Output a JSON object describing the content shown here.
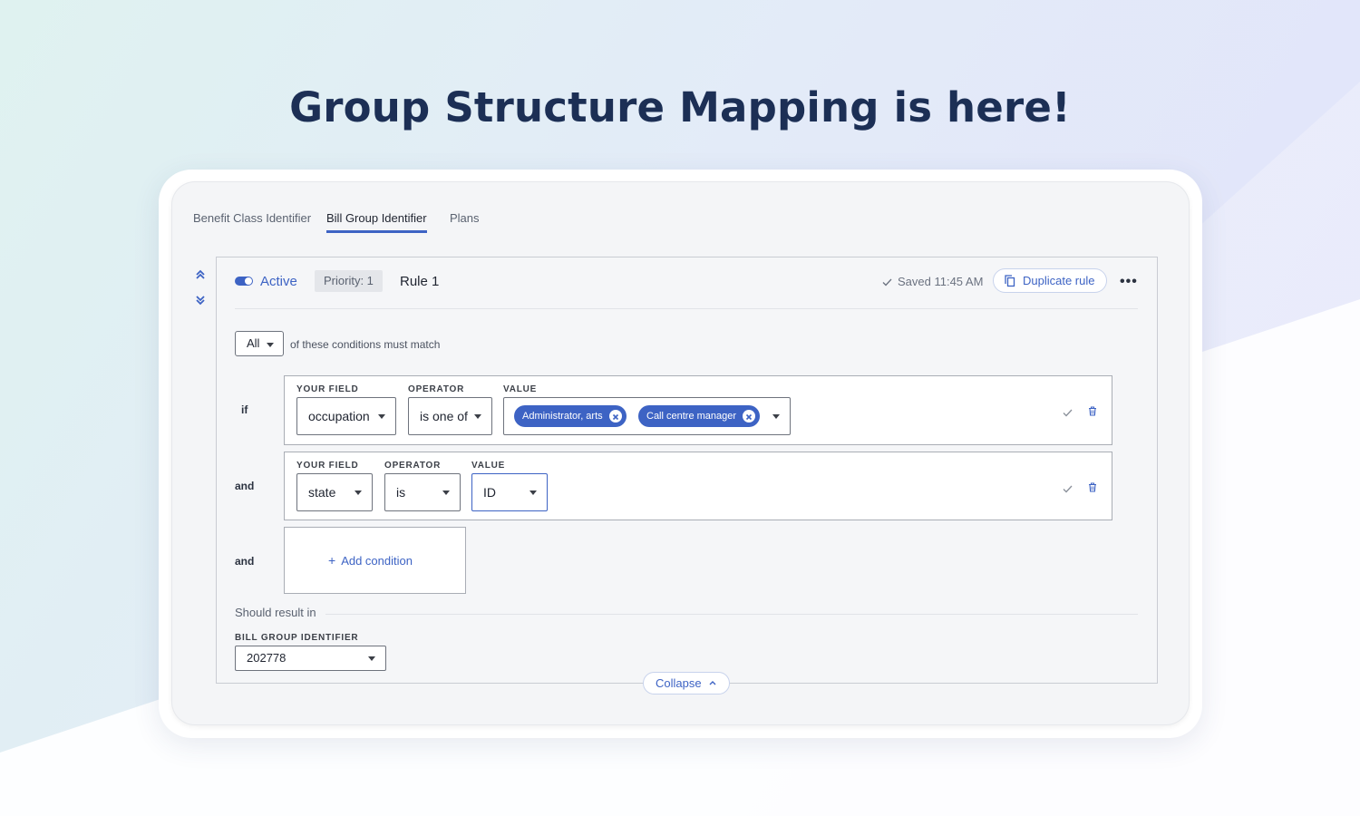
{
  "headline": "Group Structure Mapping is here!",
  "tabs": [
    {
      "label": "Benefit Class Identifier",
      "active": false
    },
    {
      "label": "Bill Group Identifier",
      "active": true
    },
    {
      "label": "Plans",
      "active": false
    }
  ],
  "rule": {
    "status_label": "Active",
    "active": true,
    "priority": "Priority: 1",
    "name": "Rule 1",
    "saved": "Saved 11:45 AM",
    "duplicate_label": "Duplicate rule",
    "match_select": "All",
    "match_text": "of these conditions must match",
    "conditions": [
      {
        "connector": "if",
        "labels": {
          "field": "YOUR FIELD",
          "operator": "OPERATOR",
          "value": "VALUE"
        },
        "field": "occupation",
        "operator": "is one of",
        "values": [
          "Administrator, arts",
          "Call centre manager"
        ]
      },
      {
        "connector": "and",
        "labels": {
          "field": "YOUR FIELD",
          "operator": "OPERATOR",
          "value": "VALUE"
        },
        "field": "state",
        "operator": "is",
        "value": "ID"
      }
    ],
    "add_connector": "and",
    "add_condition_label": "Add condition",
    "result_label": "Should result in",
    "bill_group_label": "BILL GROUP IDENTIFIER",
    "bill_group_value": "202778",
    "collapse_label": "Collapse"
  },
  "colors": {
    "accent": "#3d63c4",
    "headline": "#1c2f55"
  }
}
